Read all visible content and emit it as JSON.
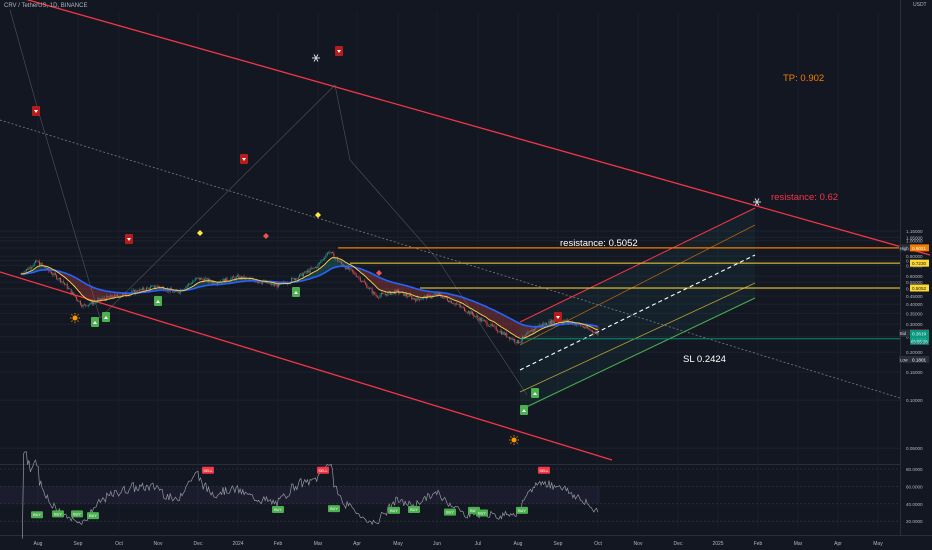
{
  "header": {
    "symbol": "CRV / TetherUS, 1D, BINANCE",
    "currency": "USDT"
  },
  "price_axis": {
    "ticks": [
      {
        "v": 1.15,
        "label": "1.15000"
      },
      {
        "v": 1.05,
        "label": "1.05000"
      },
      {
        "v": 1.0,
        "label": "1.00000"
      },
      {
        "v": 0.9,
        "label": "0.90000"
      },
      {
        "v": 0.8,
        "label": "0.80000"
      },
      {
        "v": 0.75,
        "label": "0.75000"
      },
      {
        "v": 0.7,
        "label": "0.70000"
      },
      {
        "v": 0.6,
        "label": "0.60000"
      },
      {
        "v": 0.55,
        "label": "0.55000"
      },
      {
        "v": 0.5,
        "label": "0.50000"
      },
      {
        "v": 0.45,
        "label": "0.45000"
      },
      {
        "v": 0.4,
        "label": "0.40000"
      },
      {
        "v": 0.35,
        "label": "0.35000"
      },
      {
        "v": 0.3,
        "label": "0.30000"
      },
      {
        "v": 0.25,
        "label": "0.25000"
      },
      {
        "v": 0.2,
        "label": "0.20000"
      },
      {
        "v": 0.15,
        "label": "0.15000"
      },
      {
        "v": 0.1,
        "label": "0.10000"
      },
      {
        "v": 0.05,
        "label": "0.05000"
      }
    ],
    "badges": [
      {
        "v": 0.902,
        "label": "0.9021",
        "color": "#f57c00",
        "tag": "High",
        "tag_label": "0.8822"
      },
      {
        "v": 0.723,
        "label": "0.7230",
        "color": "#fdd835"
      },
      {
        "v": 0.5052,
        "label": "0.5052",
        "color": "#fdd835"
      },
      {
        "v": 0.2629,
        "label": "0.2629",
        "color": "#f23645",
        "tag": "Ask"
      },
      {
        "v": 0.2628,
        "label": "0.2628",
        "color": "#f23645",
        "tag": "Bid"
      },
      {
        "v": 0.2619,
        "label": "0.2619",
        "color": "#089981"
      },
      {
        "v": 0.2424,
        "label": "0.2424",
        "color": "#089981"
      },
      {
        "v": 0.1801,
        "label": "0.1801",
        "color": "#2a2e39",
        "tag": "Low"
      }
    ],
    "countdown": "03:55:26"
  },
  "rsi_axis": {
    "ticks": [
      {
        "v": 80,
        "label": "80.0000"
      },
      {
        "v": 60,
        "label": "60.0000"
      },
      {
        "v": 40,
        "label": "40.0000"
      },
      {
        "v": 20,
        "label": "20.0000"
      }
    ]
  },
  "time_axis": [
    "Aug",
    "Sep",
    "Oct",
    "Nov",
    "Dec",
    "2024",
    "Feb",
    "Mar",
    "Apr",
    "May",
    "Jun",
    "Jul",
    "Aug",
    "Sep",
    "Oct",
    "Nov",
    "Dec",
    "2025",
    "Feb",
    "Mar",
    "Apr",
    "May"
  ],
  "annotations": {
    "tp": "TP: 0.902",
    "resistance_high": "resistance: 0.62",
    "resistance_mid": "resistance: 0.5052",
    "sl": "SL 0.2424"
  },
  "colors": {
    "background": "#131722",
    "channel": "#f23645",
    "ma_blue": "#2962ff",
    "ma_yellow": "#f7c948",
    "tp_line": "#f57c00",
    "level_line": "#fdd835",
    "bull": "#26a69a",
    "bear": "#ef5350"
  },
  "rsi_signals": {
    "sell": [
      "SELL",
      "SELL",
      "SELL"
    ],
    "buy": [
      "BUY",
      "BUY",
      "BUY",
      "BUY",
      "BUY",
      "BUY",
      "BUY",
      "BUY",
      "BUY",
      "BUY",
      "BUY",
      "BUY"
    ]
  },
  "chart_data": {
    "type": "line",
    "title": "CRV / TetherUS, 1D, BINANCE",
    "xlabel": "",
    "ylabel": "",
    "ylim": [
      0.05,
      1.18
    ],
    "x": [
      "2023-07-20",
      "2023-08-01",
      "2023-08-20",
      "2023-09-05",
      "2023-09-20",
      "2023-10-10",
      "2023-11-01",
      "2023-11-15",
      "2023-12-01",
      "2023-12-15",
      "2024-01-01",
      "2024-01-15",
      "2024-02-01",
      "2024-02-15",
      "2024-03-01",
      "2024-03-10",
      "2024-03-20",
      "2024-04-01",
      "2024-04-15",
      "2024-05-01",
      "2024-05-15",
      "2024-06-01",
      "2024-06-15",
      "2024-07-01",
      "2024-07-15",
      "2024-08-01",
      "2024-08-15",
      "2024-09-01",
      "2024-09-15",
      "2024-10-01"
    ],
    "series": [
      {
        "values": [
          0.62,
          0.74,
          0.56,
          0.39,
          0.43,
          0.47,
          0.52,
          0.47,
          0.58,
          0.55,
          0.59,
          0.56,
          0.52,
          0.59,
          0.69,
          0.86,
          0.71,
          0.6,
          0.45,
          0.48,
          0.43,
          0.46,
          0.4,
          0.33,
          0.28,
          0.23,
          0.29,
          0.32,
          0.3,
          0.26
        ]
      }
    ],
    "levels": [
      0.902,
      0.723,
      0.5052,
      0.2424
    ]
  }
}
